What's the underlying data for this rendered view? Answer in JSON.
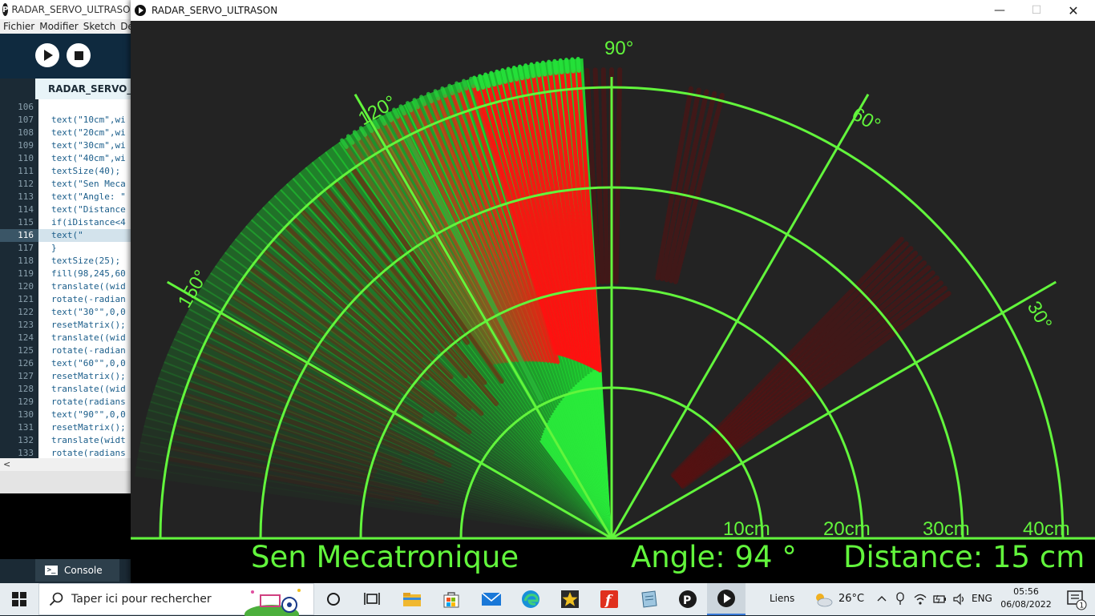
{
  "ide": {
    "title": "RADAR_SERVO_ULTRASON",
    "menu": [
      "Fichier",
      "Modifier",
      "Sketch",
      "Dép"
    ],
    "tab_label": "RADAR_SERVO_U",
    "console_label": "Console",
    "hscroll_glyph": "<",
    "code_lines": [
      {
        "n": "106",
        "t": ""
      },
      {
        "n": "107",
        "t": "text(\"10cm\",wi"
      },
      {
        "n": "108",
        "t": "text(\"20cm\",wi"
      },
      {
        "n": "109",
        "t": "text(\"30cm\",wi"
      },
      {
        "n": "110",
        "t": "text(\"40cm\",wi"
      },
      {
        "n": "111",
        "t": "textSize(40);"
      },
      {
        "n": "112",
        "t": "text(\"Sen Meca"
      },
      {
        "n": "113",
        "t": "text(\"Angle: \""
      },
      {
        "n": "114",
        "t": "text(\"Distance"
      },
      {
        "n": "115",
        "t": "if(iDistance<4"
      },
      {
        "n": "116",
        "t": "text(\""
      },
      {
        "n": "117",
        "t": "}"
      },
      {
        "n": "118",
        "t": "textSize(25);"
      },
      {
        "n": "119",
        "t": "fill(98,245,60"
      },
      {
        "n": "120",
        "t": "translate((wid"
      },
      {
        "n": "121",
        "t": "rotate(-radian"
      },
      {
        "n": "122",
        "t": "text(\"30°\",0,0"
      },
      {
        "n": "123",
        "t": "resetMatrix();"
      },
      {
        "n": "124",
        "t": "translate((wid"
      },
      {
        "n": "125",
        "t": "rotate(-radian"
      },
      {
        "n": "126",
        "t": "text(\"60°\",0,0"
      },
      {
        "n": "127",
        "t": "resetMatrix();"
      },
      {
        "n": "128",
        "t": "translate((wid"
      },
      {
        "n": "129",
        "t": "rotate(radians"
      },
      {
        "n": "130",
        "t": "text(\"90°\",0,0"
      },
      {
        "n": "131",
        "t": "resetMatrix();"
      },
      {
        "n": "132",
        "t": "translate(widt"
      },
      {
        "n": "133",
        "t": "rotate(radians"
      }
    ],
    "active_line": "116"
  },
  "radar_window": {
    "title": "RADAR_SERVO_ULTRASON",
    "minimize_glyph": "—",
    "maximize_glyph": "☐",
    "close_glyph": "✕"
  },
  "radar": {
    "angle_labels": [
      "30°",
      "60°",
      "90°",
      "120°",
      "150°"
    ],
    "range_labels": [
      "10cm",
      "20cm",
      "30cm",
      "40cm"
    ],
    "footer_brand": "Sen Mecatronique",
    "angle_readout": "Angle: 94 °",
    "distance_readout": "Distance: 15 cm",
    "colors": {
      "line": "#62f53c",
      "object": "#ff1010",
      "sweep": "#1ee632",
      "background": "#232323",
      "footer": "#000000"
    }
  },
  "taskbar": {
    "search_placeholder": "Taper ici pour rechercher",
    "links_label": "Liens",
    "temperature": "26°C",
    "language": "ENG",
    "time": "05:56",
    "date": "06/08/2022",
    "notification_count": "1",
    "apps": [
      "task-view-icon",
      "file-explorer-icon",
      "store-icon",
      "mail-icon",
      "edge-icon",
      "star-app-icon",
      "foxit-icon",
      "notes-icon",
      "processing-icon",
      "processing-sketch-icon"
    ]
  }
}
